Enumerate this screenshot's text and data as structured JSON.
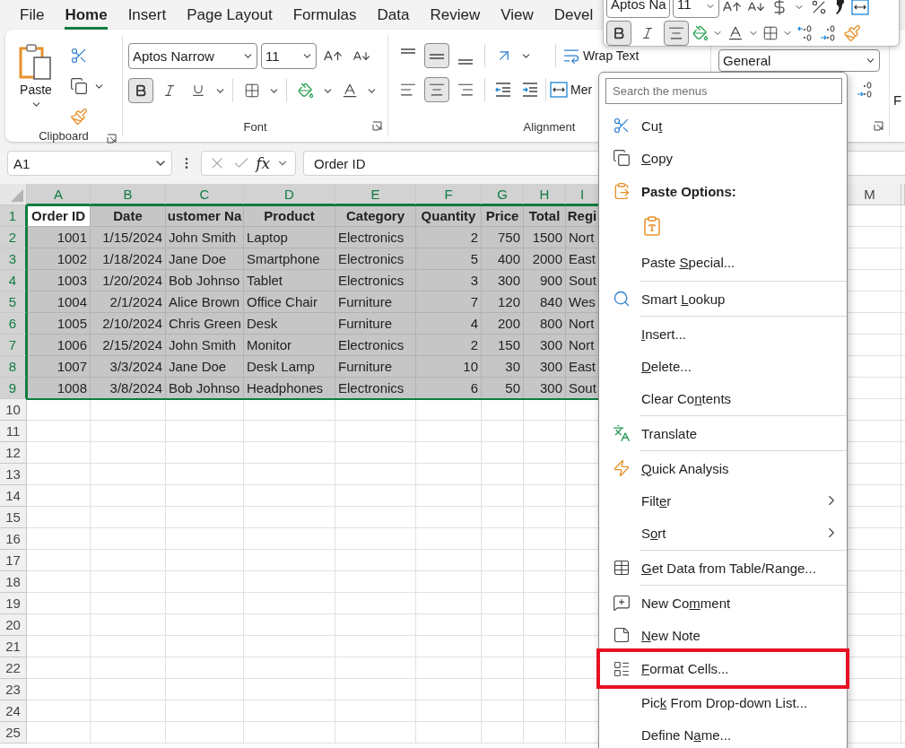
{
  "tabs": [
    {
      "label": "File",
      "selected": false
    },
    {
      "label": "Home",
      "selected": true
    },
    {
      "label": "Insert",
      "selected": false
    },
    {
      "label": "Page Layout",
      "selected": false
    },
    {
      "label": "Formulas",
      "selected": false
    },
    {
      "label": "Data",
      "selected": false
    },
    {
      "label": "Review",
      "selected": false
    },
    {
      "label": "View",
      "selected": false
    },
    {
      "label": "Devel",
      "selected": false
    }
  ],
  "ribbon": {
    "clipboard": {
      "paste_label": "Paste",
      "group_label": "Clipboard"
    },
    "font": {
      "font_name": "Aptos Narrow",
      "font_size": "11",
      "bold": true,
      "italic": false,
      "underline": false,
      "group_label": "Font"
    },
    "alignment": {
      "vertical": [
        {
          "selected": false
        },
        {
          "selected": true
        },
        {
          "selected": false
        }
      ],
      "horizontal": [
        {
          "selected": false
        },
        {
          "selected": true
        },
        {
          "selected": false
        }
      ],
      "wrap_text": "Wrap Text",
      "merge": "Mer",
      "group_label": "Alignment"
    },
    "number": {
      "format": "General"
    },
    "next_group": {
      "label": "F"
    }
  },
  "mini_toolbar": {
    "font_name": "Aptos Na",
    "font_size": "11",
    "bold": true,
    "italic": false,
    "center": true
  },
  "formula_bar": {
    "name_box": "A1",
    "fx": "fx",
    "formula": "Order ID"
  },
  "sheet": {
    "columns": [
      {
        "label": "A",
        "selected": true
      },
      {
        "label": "B",
        "selected": true
      },
      {
        "label": "C",
        "selected": true
      },
      {
        "label": "D",
        "selected": true
      },
      {
        "label": "E",
        "selected": true
      },
      {
        "label": "F",
        "selected": true
      },
      {
        "label": "G",
        "selected": true
      },
      {
        "label": "H",
        "selected": true
      },
      {
        "label": "I",
        "selected": true
      },
      {
        "label": "M",
        "selected": false
      }
    ],
    "rows": [
      {
        "number": "1",
        "selected": true,
        "kind": "header",
        "active_first_cell": true,
        "cells": [
          "Order ID",
          "Date",
          "ustomer Na",
          "Product",
          "Category",
          "Quantity",
          "Price",
          "Total",
          "Regi"
        ]
      },
      {
        "number": "2",
        "selected": true,
        "kind": "data",
        "active_first_cell": false,
        "cells": [
          "1001",
          "1/15/2024",
          "John Smith",
          "Laptop",
          "Electronics",
          "2",
          "750",
          "1500",
          "Nort"
        ]
      },
      {
        "number": "3",
        "selected": true,
        "kind": "data",
        "active_first_cell": false,
        "cells": [
          "1002",
          "1/18/2024",
          "Jane Doe",
          "Smartphone",
          "Electronics",
          "5",
          "400",
          "2000",
          "East"
        ]
      },
      {
        "number": "4",
        "selected": true,
        "kind": "data",
        "active_first_cell": false,
        "cells": [
          "1003",
          "1/20/2024",
          "Bob Johnso",
          "Tablet",
          "Electronics",
          "3",
          "300",
          "900",
          "Sout"
        ]
      },
      {
        "number": "5",
        "selected": true,
        "kind": "data",
        "active_first_cell": false,
        "cells": [
          "1004",
          "2/1/2024",
          "Alice Brown",
          "Office Chair",
          "Furniture",
          "7",
          "120",
          "840",
          "Wes"
        ]
      },
      {
        "number": "6",
        "selected": true,
        "kind": "data",
        "active_first_cell": false,
        "cells": [
          "1005",
          "2/10/2024",
          "Chris Green",
          "Desk",
          "Furniture",
          "4",
          "200",
          "800",
          "Nort"
        ]
      },
      {
        "number": "7",
        "selected": true,
        "kind": "data",
        "active_first_cell": false,
        "cells": [
          "1006",
          "2/15/2024",
          "John Smith",
          "Monitor",
          "Electronics",
          "2",
          "150",
          "300",
          "Nort"
        ]
      },
      {
        "number": "8",
        "selected": true,
        "kind": "data",
        "active_first_cell": false,
        "cells": [
          "1007",
          "3/3/2024",
          "Jane Doe",
          "Desk Lamp",
          "Furniture",
          "10",
          "30",
          "300",
          "East"
        ]
      },
      {
        "number": "9",
        "selected": true,
        "kind": "data",
        "active_first_cell": false,
        "cells": [
          "1008",
          "3/8/2024",
          "Bob Johnso",
          "Headphones",
          "Electronics",
          "6",
          "50",
          "300",
          "Sout"
        ]
      },
      {
        "number": "10",
        "selected": false,
        "kind": "empty"
      },
      {
        "number": "11",
        "selected": false,
        "kind": "empty"
      },
      {
        "number": "12",
        "selected": false,
        "kind": "empty"
      },
      {
        "number": "13",
        "selected": false,
        "kind": "empty"
      },
      {
        "number": "14",
        "selected": false,
        "kind": "empty"
      },
      {
        "number": "15",
        "selected": false,
        "kind": "empty"
      },
      {
        "number": "16",
        "selected": false,
        "kind": "empty"
      },
      {
        "number": "17",
        "selected": false,
        "kind": "empty"
      },
      {
        "number": "18",
        "selected": false,
        "kind": "empty"
      },
      {
        "number": "19",
        "selected": false,
        "kind": "empty"
      },
      {
        "number": "20",
        "selected": false,
        "kind": "empty"
      },
      {
        "number": "21",
        "selected": false,
        "kind": "empty"
      },
      {
        "number": "22",
        "selected": false,
        "kind": "empty"
      },
      {
        "number": "23",
        "selected": false,
        "kind": "empty"
      },
      {
        "number": "24",
        "selected": false,
        "kind": "empty"
      },
      {
        "number": "25",
        "selected": false,
        "kind": "empty"
      }
    ]
  },
  "context_menu": {
    "search_placeholder": "Search the menus",
    "items": [
      {
        "kind": "item",
        "label": [
          {
            "t": "Cu"
          },
          {
            "k": "t"
          }
        ],
        "submenu": false,
        "highlighted": false
      },
      {
        "kind": "item",
        "label": [
          {
            "k": "C"
          },
          {
            "t": "opy"
          }
        ],
        "submenu": false,
        "highlighted": false
      },
      {
        "kind": "header",
        "label": [
          {
            "t": "Paste Options:"
          }
        ]
      },
      {
        "kind": "paste_choices"
      },
      {
        "kind": "item",
        "label": [
          {
            "t": "Paste "
          },
          {
            "k": "S"
          },
          {
            "t": "pecial..."
          }
        ],
        "submenu": false,
        "highlighted": false
      },
      {
        "kind": "separator"
      },
      {
        "kind": "item",
        "label": [
          {
            "t": "Smart "
          },
          {
            "k": "L"
          },
          {
            "t": "ookup"
          }
        ],
        "submenu": false,
        "highlighted": false
      },
      {
        "kind": "separator"
      },
      {
        "kind": "item",
        "label": [
          {
            "k": "I"
          },
          {
            "t": "nsert..."
          }
        ],
        "submenu": false,
        "highlighted": false
      },
      {
        "kind": "item",
        "label": [
          {
            "k": "D"
          },
          {
            "t": "elete..."
          }
        ],
        "submenu": false,
        "highlighted": false
      },
      {
        "kind": "item",
        "label": [
          {
            "t": "Clear Co"
          },
          {
            "k": "n"
          },
          {
            "t": "tents"
          }
        ],
        "submenu": false,
        "highlighted": false
      },
      {
        "kind": "separator"
      },
      {
        "kind": "item",
        "label": [
          {
            "t": "Translate"
          }
        ],
        "submenu": false,
        "highlighted": false
      },
      {
        "kind": "separator"
      },
      {
        "kind": "item",
        "label": [
          {
            "k": "Q"
          },
          {
            "t": "uick Analysis"
          }
        ],
        "submenu": false,
        "highlighted": false
      },
      {
        "kind": "item",
        "label": [
          {
            "t": "Filt"
          },
          {
            "k": "e"
          },
          {
            "t": "r"
          }
        ],
        "submenu": true,
        "highlighted": false
      },
      {
        "kind": "item",
        "label": [
          {
            "t": "S"
          },
          {
            "k": "o"
          },
          {
            "t": "rt"
          }
        ],
        "submenu": true,
        "highlighted": false
      },
      {
        "kind": "separator"
      },
      {
        "kind": "item",
        "label": [
          {
            "k": "G"
          },
          {
            "t": "et Data from Table/Range..."
          }
        ],
        "submenu": false,
        "highlighted": false
      },
      {
        "kind": "separator"
      },
      {
        "kind": "item",
        "label": [
          {
            "t": "New Co"
          },
          {
            "k": "m"
          },
          {
            "t": "ment"
          }
        ],
        "submenu": false,
        "highlighted": false
      },
      {
        "kind": "item",
        "label": [
          {
            "k": "N"
          },
          {
            "t": "ew Note"
          }
        ],
        "submenu": false,
        "highlighted": false
      },
      {
        "kind": "item",
        "label": [
          {
            "k": "F"
          },
          {
            "t": "ormat Cells..."
          }
        ],
        "submenu": false,
        "highlighted": true
      },
      {
        "kind": "item",
        "label": [
          {
            "t": "Pic"
          },
          {
            "k": "k"
          },
          {
            "t": " From Drop-down List..."
          }
        ],
        "submenu": false,
        "highlighted": false
      },
      {
        "kind": "item",
        "label": [
          {
            "t": "Define N"
          },
          {
            "k": "a"
          },
          {
            "t": "me..."
          }
        ],
        "submenu": false,
        "highlighted": false
      }
    ]
  }
}
